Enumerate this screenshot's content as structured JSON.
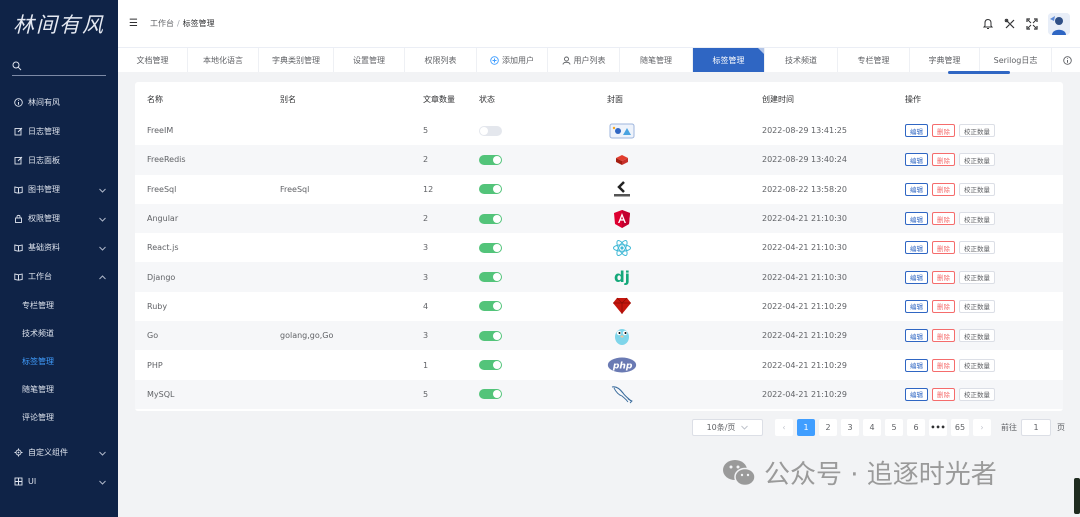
{
  "sidebar": {
    "logo": "林间有风",
    "search_placeholder": "",
    "items": [
      {
        "label": "林间有风",
        "icon": "info-icon"
      },
      {
        "label": "日志管理",
        "icon": "edit-icon"
      },
      {
        "label": "日志面板",
        "icon": "edit-icon"
      },
      {
        "label": "图书管理",
        "icon": "book-icon",
        "chevron": "down"
      },
      {
        "label": "权限管理",
        "icon": "lock-icon",
        "chevron": "down"
      },
      {
        "label": "基础资料",
        "icon": "book-icon",
        "chevron": "down"
      },
      {
        "label": "工作台",
        "icon": "book-icon",
        "chevron": "up"
      }
    ],
    "sub_items": [
      {
        "label": "专栏管理",
        "active": false
      },
      {
        "label": "技术频道",
        "active": false
      },
      {
        "label": "标签管理",
        "active": true
      },
      {
        "label": "随笔管理",
        "active": false
      },
      {
        "label": "评论管理",
        "active": false
      }
    ],
    "bottom_items": [
      {
        "label": "自定义组件",
        "icon": "gear-icon",
        "chevron": "down"
      },
      {
        "label": "UI",
        "icon": "grid-icon",
        "chevron": "down"
      }
    ]
  },
  "header": {
    "breadcrumb_parent": "工作台",
    "breadcrumb_sep": "/",
    "breadcrumb_current": "标签管理"
  },
  "tabs": [
    {
      "label": "文档管理"
    },
    {
      "label": "本地化语言"
    },
    {
      "label": "字典类别管理"
    },
    {
      "label": "设置管理"
    },
    {
      "label": "权限列表"
    },
    {
      "label": "添加用户",
      "icon": "plus-circle-icon"
    },
    {
      "label": "用户列表",
      "icon": "user-icon"
    },
    {
      "label": "随笔管理"
    },
    {
      "label": "标签管理",
      "active": true
    },
    {
      "label": "技术频道"
    },
    {
      "label": "专栏管理"
    },
    {
      "label": "字典管理"
    },
    {
      "label": "Serilog日志"
    },
    {
      "label": "",
      "icon": "info-icon"
    }
  ],
  "table": {
    "headers": {
      "name": "名称",
      "alias": "别名",
      "count": "文章数量",
      "state": "状态",
      "cover": "封面",
      "created": "创建时间",
      "ops": "操作"
    },
    "ops": {
      "edit": "编辑",
      "delete": "删除",
      "fix": "校正数量"
    },
    "rows": [
      {
        "name": "FreeIM",
        "alias": "",
        "count": "5",
        "enabled": false,
        "cover": "freeim",
        "created": "2022-08-29 13:41:25"
      },
      {
        "name": "FreeRedis",
        "alias": "",
        "count": "2",
        "enabled": true,
        "cover": "redis",
        "created": "2022-08-29 13:40:24"
      },
      {
        "name": "FreeSql",
        "alias": "FreeSql",
        "count": "12",
        "enabled": true,
        "cover": "freesql",
        "created": "2022-08-22 13:58:20"
      },
      {
        "name": "Angular",
        "alias": "",
        "count": "2",
        "enabled": true,
        "cover": "angular",
        "created": "2022-04-21 21:10:30"
      },
      {
        "name": "React.js",
        "alias": "",
        "count": "3",
        "enabled": true,
        "cover": "react",
        "created": "2022-04-21 21:10:30"
      },
      {
        "name": "Django",
        "alias": "",
        "count": "3",
        "enabled": true,
        "cover": "django",
        "created": "2022-04-21 21:10:30"
      },
      {
        "name": "Ruby",
        "alias": "",
        "count": "4",
        "enabled": true,
        "cover": "ruby",
        "created": "2022-04-21 21:10:29"
      },
      {
        "name": "Go",
        "alias": "golang,go,Go",
        "count": "3",
        "enabled": true,
        "cover": "go",
        "created": "2022-04-21 21:10:29"
      },
      {
        "name": "PHP",
        "alias": "",
        "count": "1",
        "enabled": true,
        "cover": "php",
        "created": "2022-04-21 21:10:29"
      },
      {
        "name": "MySQL",
        "alias": "",
        "count": "5",
        "enabled": true,
        "cover": "mysql",
        "created": "2022-04-21 21:10:29"
      }
    ]
  },
  "pagination": {
    "page_size": "10条/页",
    "pages": [
      "1",
      "2",
      "3",
      "4",
      "5",
      "6",
      "•••",
      "65"
    ],
    "current": "1",
    "goto_label": "前往",
    "goto_value": "1",
    "goto_suffix": "页"
  },
  "watermark": {
    "text": "公众号 · 追逐时光者"
  },
  "colors": {
    "sidebar_bg": "#0f2347",
    "active_tab": "#2f66c3",
    "toggle_on": "#53c47a",
    "delete_red": "#f56c6c",
    "page_active": "#409eff"
  }
}
